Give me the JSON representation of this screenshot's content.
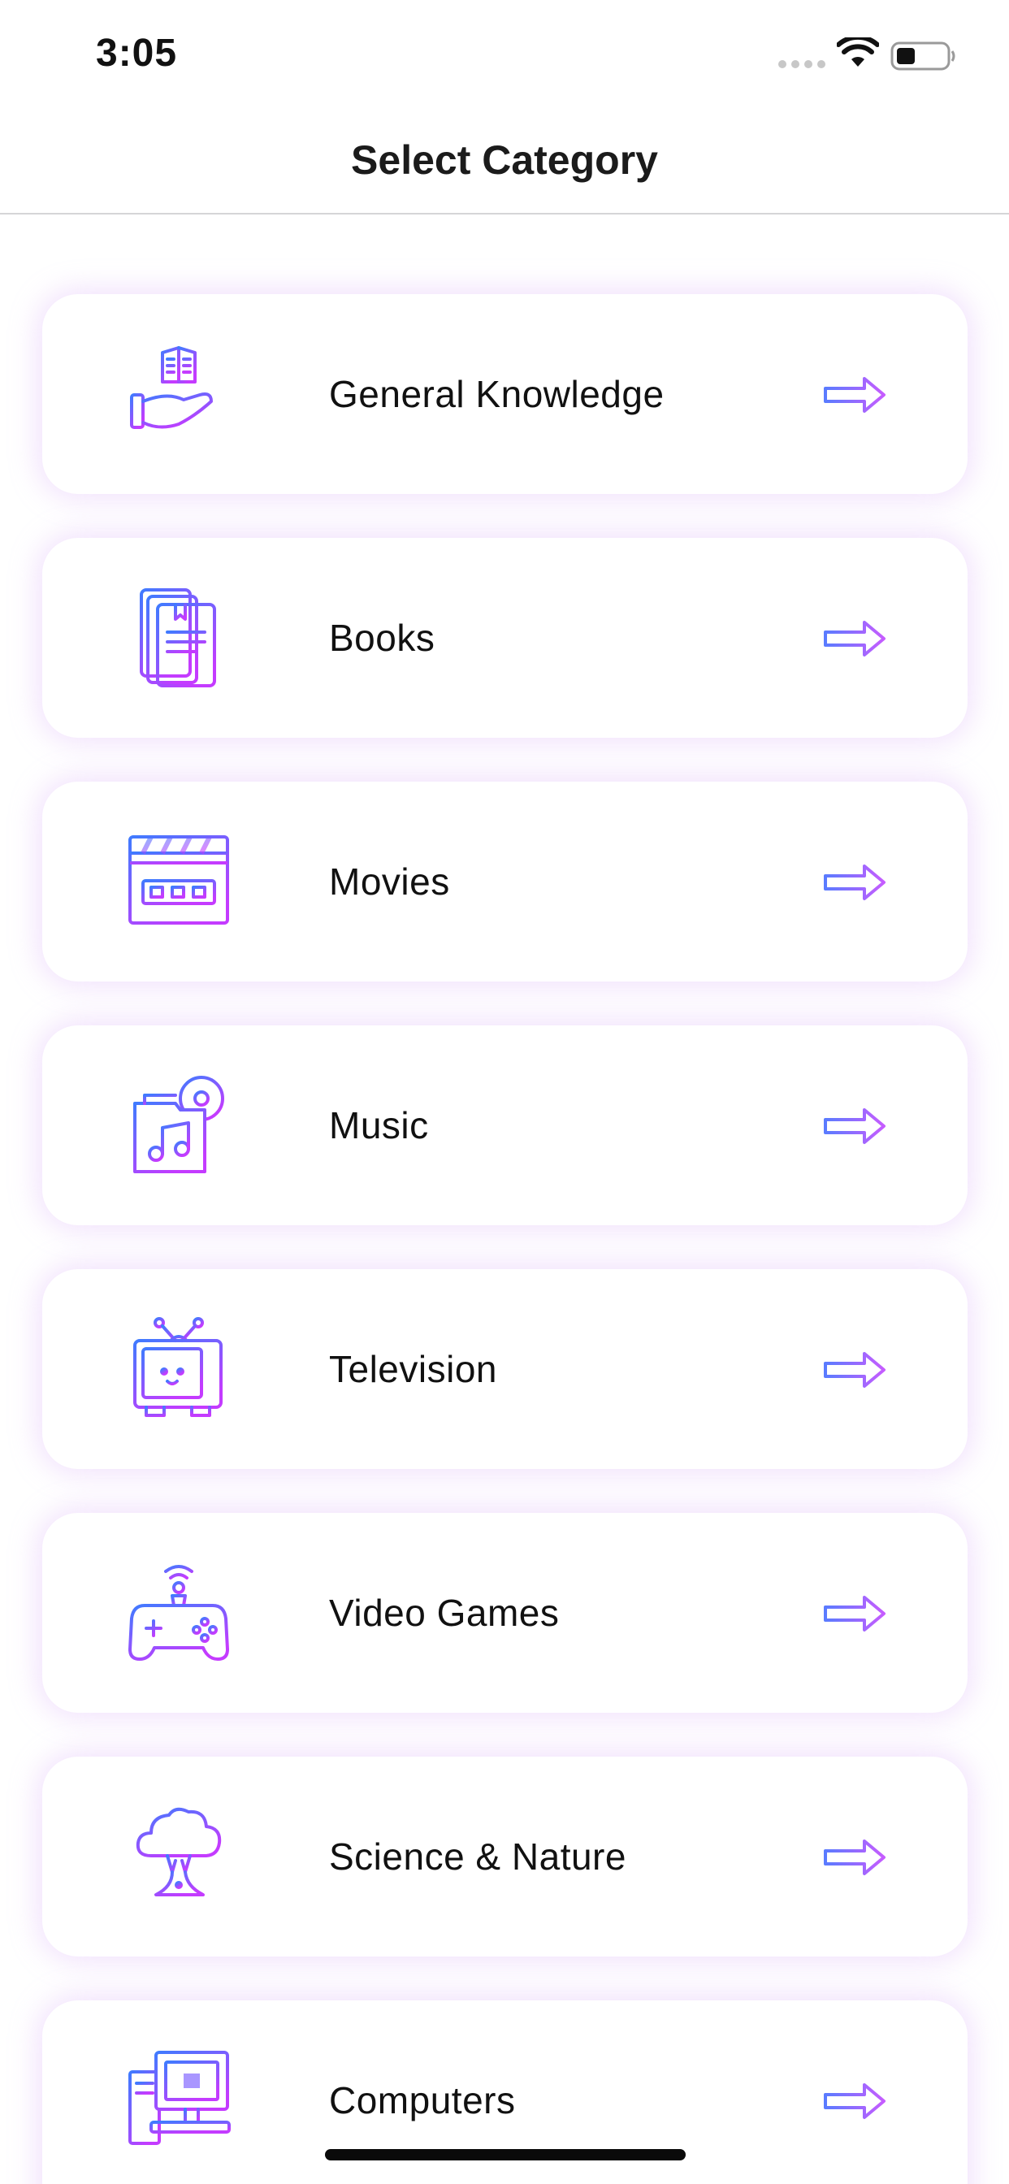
{
  "status_bar": {
    "time": "3:05"
  },
  "nav": {
    "title": "Select Category"
  },
  "colors": {
    "icon_gradient_start": "#3f7bff",
    "icon_gradient_end": "#c43bff",
    "card_glow": "#d8aaf5"
  },
  "categories": [
    {
      "label": "General Knowledge",
      "icon": "book-hand-icon"
    },
    {
      "label": "Books",
      "icon": "books-icon"
    },
    {
      "label": "Movies",
      "icon": "clapperboard-icon"
    },
    {
      "label": "Music",
      "icon": "music-folder-icon"
    },
    {
      "label": "Television",
      "icon": "tv-icon"
    },
    {
      "label": "Video Games",
      "icon": "gamepad-icon"
    },
    {
      "label": "Science & Nature",
      "icon": "tree-icon"
    },
    {
      "label": "Computers",
      "icon": "computer-icon"
    }
  ]
}
